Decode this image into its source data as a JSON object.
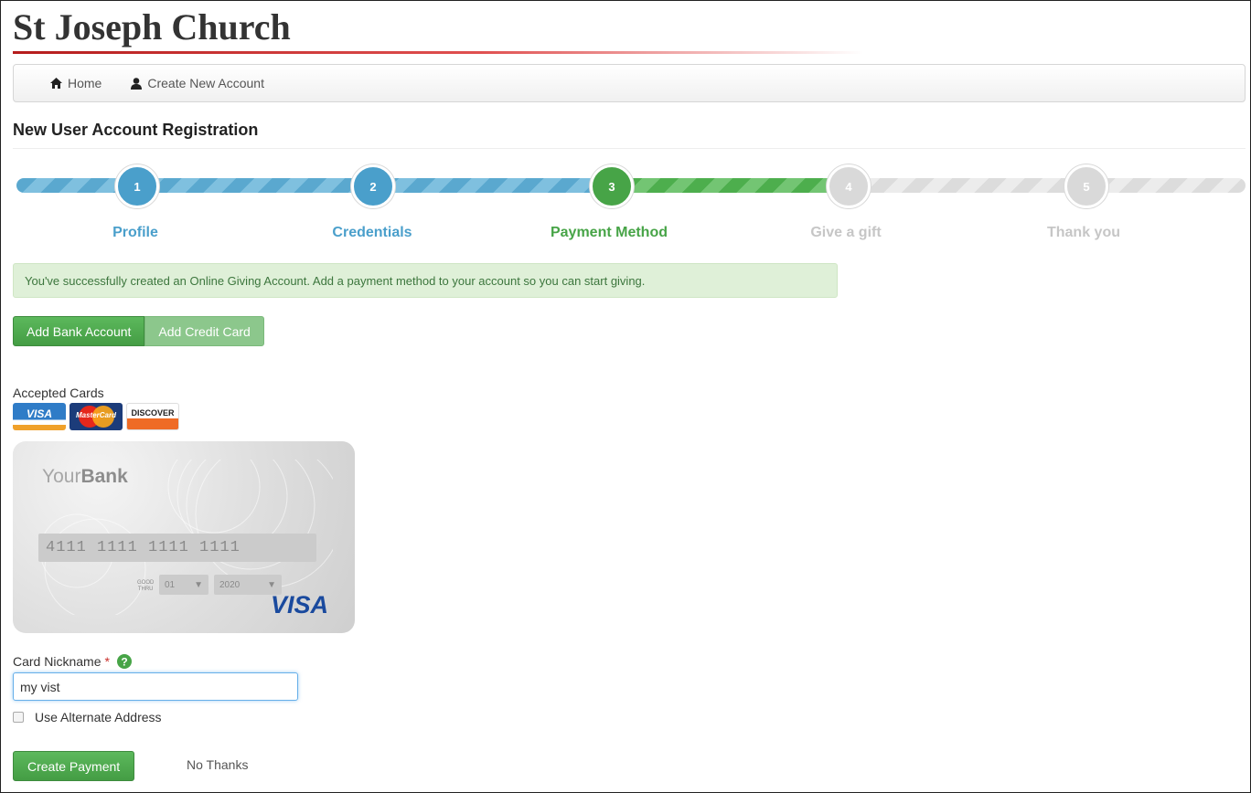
{
  "site": {
    "title": "St Joseph Church"
  },
  "nav": {
    "items": [
      {
        "label": "Home",
        "icon": "home-icon"
      },
      {
        "label": "Create New Account",
        "icon": "user-icon"
      }
    ]
  },
  "page": {
    "heading": "New User Account Registration"
  },
  "wizard": {
    "current_step": 3,
    "steps": [
      {
        "number": "1",
        "label": "Profile",
        "state": "done"
      },
      {
        "number": "2",
        "label": "Credentials",
        "state": "done"
      },
      {
        "number": "3",
        "label": "Payment Method",
        "state": "active"
      },
      {
        "number": "4",
        "label": "Give a gift",
        "state": "todo"
      },
      {
        "number": "5",
        "label": "Thank you",
        "state": "todo"
      }
    ]
  },
  "alert": {
    "message": "You've successfully created an Online Giving Account. Add a payment method to your account so you can start giving."
  },
  "payment_tabs": {
    "bank_label": "Add Bank Account",
    "credit_label": "Add Credit Card"
  },
  "accepted_cards": {
    "label": "Accepted Cards",
    "logos": [
      {
        "text": "VISA",
        "icon": "visa-logo"
      },
      {
        "text": "MasterCard",
        "icon": "mastercard-logo"
      },
      {
        "text": "DISCOVER",
        "icon": "discover-logo"
      }
    ]
  },
  "card_preview": {
    "bank_prefix": "Your",
    "bank_suffix": "Bank",
    "number": "4111 1111 1111 1111",
    "good_thru_top": "GOOD",
    "good_thru_bottom": "THRU",
    "month": "01",
    "year": "2020",
    "brand": "VISA"
  },
  "form": {
    "nickname_label": "Card Nickname",
    "required_mark": "*",
    "nickname_value": "my vist",
    "alt_address_label": "Use Alternate Address",
    "alt_address_checked": false,
    "submit_label": "Create Payment",
    "cancel_label": "No Thanks"
  },
  "colors": {
    "success": "#47a447",
    "info": "#4a9fcb",
    "inactive": "#d9d9d9",
    "title_rule": "#b51c1c"
  }
}
